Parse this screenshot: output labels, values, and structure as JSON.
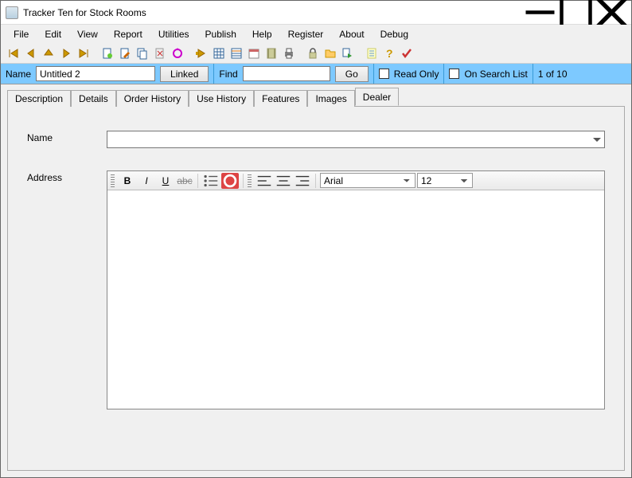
{
  "window": {
    "title": "Tracker Ten for Stock Rooms"
  },
  "menus": {
    "file": "File",
    "edit": "Edit",
    "view": "View",
    "report": "Report",
    "utilities": "Utilities",
    "publish": "Publish",
    "help": "Help",
    "register": "Register",
    "about": "About",
    "debug": "Debug"
  },
  "filter": {
    "name_label": "Name",
    "name_value": "Untitled 2",
    "linked_btn": "Linked",
    "find_label": "Find",
    "find_value": "",
    "go_btn": "Go",
    "readonly_label": "Read Only",
    "onsearch_label": "On Search List",
    "counter": "1 of 10"
  },
  "tabs": {
    "description": "Description",
    "details": "Details",
    "order_history": "Order History",
    "use_history": "Use History",
    "features": "Features",
    "images": "Images",
    "dealer": "Dealer"
  },
  "form": {
    "name_label": "Name",
    "address_label": "Address"
  },
  "editor": {
    "font": "Arial",
    "size": "12"
  }
}
